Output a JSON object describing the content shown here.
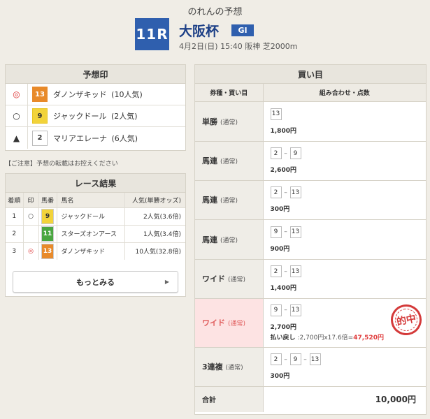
{
  "header": {
    "title": "のれんの予想",
    "race_no": "11R",
    "race_name": "大阪杯",
    "grade": "GI",
    "info": "4月2日(日) 15:40 阪神 芝2000m"
  },
  "prediction": {
    "title": "予想印",
    "rows": [
      {
        "mark": "◎",
        "number": "13",
        "name": "ダノンザキッド",
        "popularity": "(10人気)",
        "waku_color": "#e88a2a"
      },
      {
        "mark": "○",
        "number": "9",
        "name": "ジャックドール",
        "popularity": "(2人気)",
        "waku_color": "#f2d33a"
      },
      {
        "mark": "▲",
        "number": "2",
        "name": "マリアエレーナ",
        "popularity": "(6人気)",
        "waku_color": "#ffffff"
      }
    ]
  },
  "notice": "【ご注意】予想の転載はお控えください",
  "result": {
    "title": "レース結果",
    "headers": [
      "着順",
      "印",
      "馬番",
      "馬名",
      "人気(単勝オッズ)"
    ],
    "rows": [
      {
        "rank": "1",
        "mark": "○",
        "number": "9",
        "name": "ジャックドール",
        "pop": "2人気(3.6倍)"
      },
      {
        "rank": "2",
        "mark": "",
        "number": "11",
        "name": "スターズオンアース",
        "pop": "1人気(3.4倍)"
      },
      {
        "rank": "3",
        "mark": "◎",
        "number": "13",
        "name": "ダノンザキッド",
        "pop": "10人気(32.8倍)"
      }
    ],
    "more_label": "もっとみる",
    "more_arrow": "▶"
  },
  "bets": {
    "title": "買い目",
    "col_type": "券種・買い目",
    "col_combo": "組み合わせ・点数",
    "rows": [
      {
        "type": "単勝",
        "sub": "(通常)",
        "nums": [
          "13"
        ],
        "amount": "1,800円"
      },
      {
        "type": "馬連",
        "sub": "(通常)",
        "nums": [
          "2",
          "9"
        ],
        "amount": "2,600円"
      },
      {
        "type": "馬連",
        "sub": "(通常)",
        "nums": [
          "2",
          "13"
        ],
        "amount": "300円"
      },
      {
        "type": "馬連",
        "sub": "(通常)",
        "nums": [
          "9",
          "13"
        ],
        "amount": "900円"
      },
      {
        "type": "ワイド",
        "sub": "(通常)",
        "nums": [
          "2",
          "13"
        ],
        "amount": "1,400円"
      },
      {
        "type": "ワイド",
        "sub": "(通常)",
        "nums": [
          "9",
          "13"
        ],
        "amount": "2,700円",
        "hit": true,
        "payout_label": "払い戻し",
        "payout_calc": ":2,700円x17.6倍=",
        "payout_value": "47,520円",
        "stamp": "的中"
      },
      {
        "type": "3連複",
        "sub": "(通常)",
        "nums": [
          "2",
          "9",
          "13"
        ],
        "amount": "300円"
      }
    ],
    "total_label": "合計",
    "total_value": "10,000円"
  }
}
